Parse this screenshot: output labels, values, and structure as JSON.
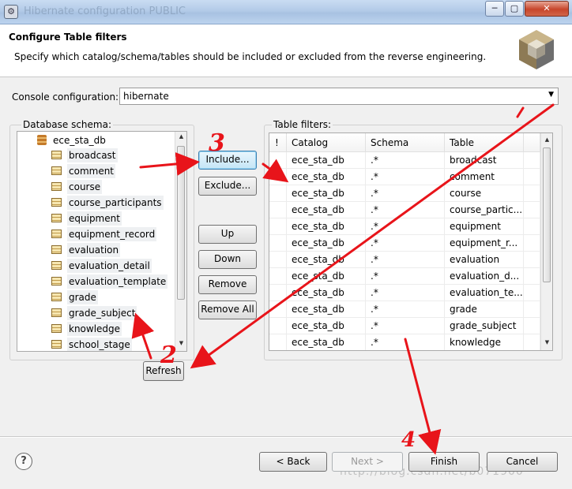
{
  "window": {
    "title": "Hibernate configuration PUBLIC",
    "controls": [
      "─",
      "▢",
      "✕"
    ]
  },
  "header": {
    "title": "Configure Table filters",
    "description": "Specify which catalog/schema/tables should be included or excluded from the reverse engineering."
  },
  "console": {
    "label": "Console configuration:",
    "value": "hibernate"
  },
  "schema": {
    "label": "Database schema:",
    "root": "ece_sta_db",
    "items": [
      "broadcast",
      "comment",
      "course",
      "course_participants",
      "equipment",
      "equipment_record",
      "evaluation",
      "evaluation_detail",
      "evaluation_template",
      "grade",
      "grade_subject",
      "knowledge",
      "school_stage"
    ]
  },
  "actions": {
    "include": "Include...",
    "exclude": "Exclude...",
    "up": "Up",
    "down": "Down",
    "remove": "Remove",
    "remove_all": "Remove All",
    "refresh": "Refresh"
  },
  "filters": {
    "label": "Table filters:",
    "columns": [
      "!",
      "Catalog",
      "Schema",
      "Table"
    ],
    "rows": [
      [
        "ece_sta_db",
        ".*",
        "broadcast"
      ],
      [
        "ece_sta_db",
        ".*",
        "comment"
      ],
      [
        "ece_sta_db",
        ".*",
        "course"
      ],
      [
        "ece_sta_db",
        ".*",
        "course_partic..."
      ],
      [
        "ece_sta_db",
        ".*",
        "equipment"
      ],
      [
        "ece_sta_db",
        ".*",
        "equipment_r..."
      ],
      [
        "ece_sta_db",
        ".*",
        "evaluation"
      ],
      [
        "ece_sta_db",
        ".*",
        "evaluation_d..."
      ],
      [
        "ece_sta_db",
        ".*",
        "evaluation_te..."
      ],
      [
        "ece_sta_db",
        ".*",
        "grade"
      ],
      [
        "ece_sta_db",
        ".*",
        "grade_subject"
      ],
      [
        "ece_sta_db",
        ".*",
        "knowledge"
      ]
    ]
  },
  "footer": {
    "help": "?",
    "back": "< Back",
    "next": "Next >",
    "finish": "Finish",
    "cancel": "Cancel"
  },
  "watermark": "http://blog.csdn.net/b071900",
  "annotations": [
    "1",
    "2",
    "3",
    "4"
  ],
  "colors": {
    "annotation": "#e8141a",
    "focus_border": "#3c7fb1"
  }
}
